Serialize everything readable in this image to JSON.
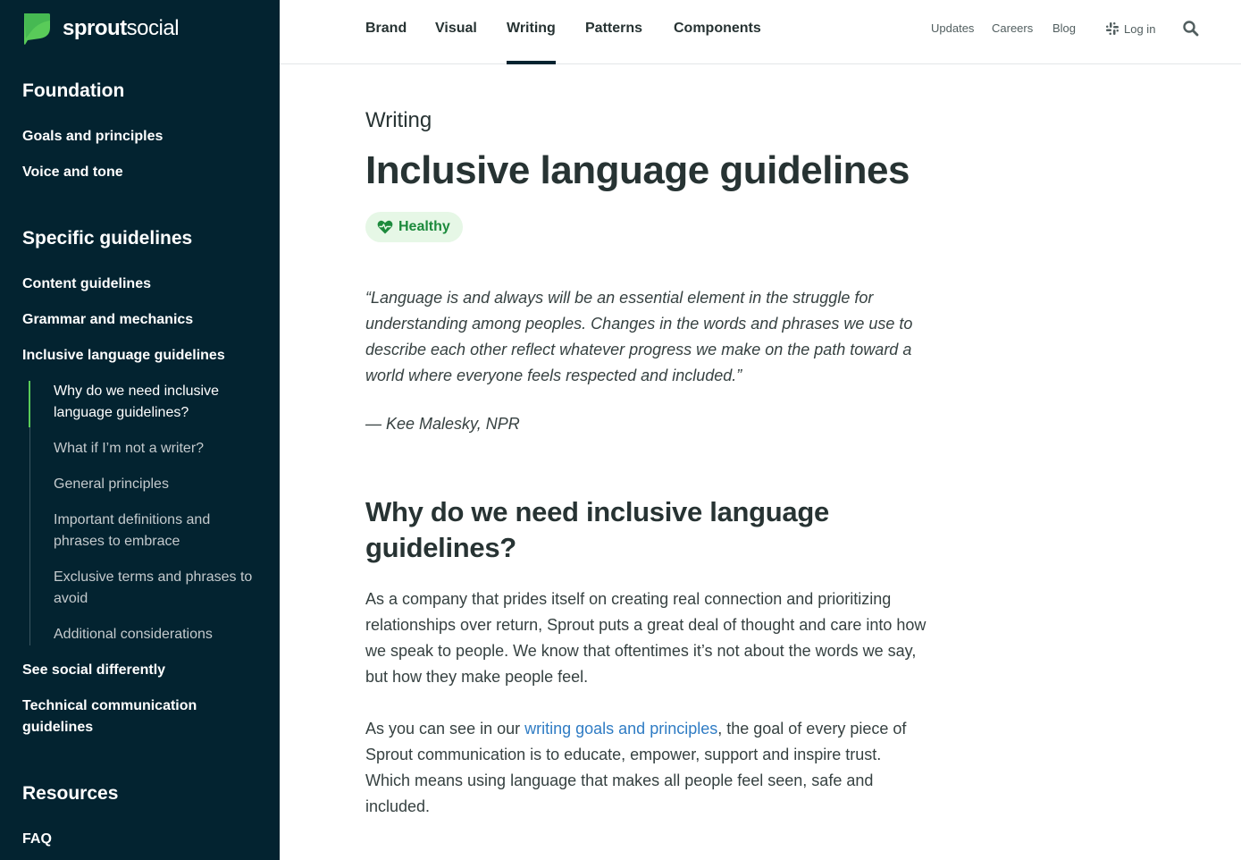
{
  "brand": {
    "logo_text_bold": "sprout",
    "logo_text_light": "social",
    "logo_icon": "sprout-leaf-icon",
    "accent_green": "#59cb59"
  },
  "sidebar": {
    "background": "#032330",
    "sections": [
      {
        "heading": "Foundation",
        "items": [
          "Goals and principles",
          "Voice and tone"
        ]
      },
      {
        "heading": "Specific guidelines",
        "items": [
          "Content guidelines",
          "Grammar and mechanics",
          "Inclusive language guidelines"
        ],
        "active_item": "Inclusive language guidelines",
        "sub_items": [
          "Why do we need inclusive language guidelines?",
          "What if I’m not a writer?",
          "General principles",
          "Important definitions and phrases to embrace",
          "Exclusive terms and phrases to avoid",
          "Additional considerations"
        ],
        "active_sub_item": "Why do we need inclusive language guidelines?",
        "items_after": [
          "See social differently",
          "Technical communication guidelines"
        ]
      },
      {
        "heading": "Resources",
        "items": [
          "FAQ"
        ]
      }
    ]
  },
  "topnav": {
    "main": [
      "Brand",
      "Visual",
      "Writing",
      "Patterns",
      "Components"
    ],
    "active": "Writing",
    "utility": [
      "Updates",
      "Careers",
      "Blog"
    ],
    "login_label": "Log in",
    "login_icon": "slack-icon",
    "search_icon": "search-icon"
  },
  "page": {
    "eyebrow": "Writing",
    "title": "Inclusive language guidelines",
    "status_badge": {
      "label": "Healthy",
      "icon": "heart-pulse-icon",
      "color": "#1c8a3c"
    },
    "quote": "“Language is and always will be an essential element in the struggle for understanding among peoples. Changes in the words and phrases we use to describe each other reflect whatever progress we make on the path toward a world where everyone feels respected and included.”",
    "quote_author": "— Kee Malesky, NPR",
    "section_heading": "Why do we need inclusive language guidelines?",
    "paragraph_1": "As a company that prides itself on creating real connection and prioritizing relationships over return, Sprout puts a great deal of thought and care into how we speak to people. We know that oftentimes it’s not about the words we say, but how they make people feel.",
    "paragraph_2_before_link": "As you can see in our ",
    "paragraph_2_link": "writing goals and principles",
    "paragraph_2_after_link": ", the goal of every piece of Sprout communication is to educate, empower, support and inspire trust. Which means using language that makes all people feel seen, safe and included.",
    "link_color": "#2f7cc4"
  }
}
